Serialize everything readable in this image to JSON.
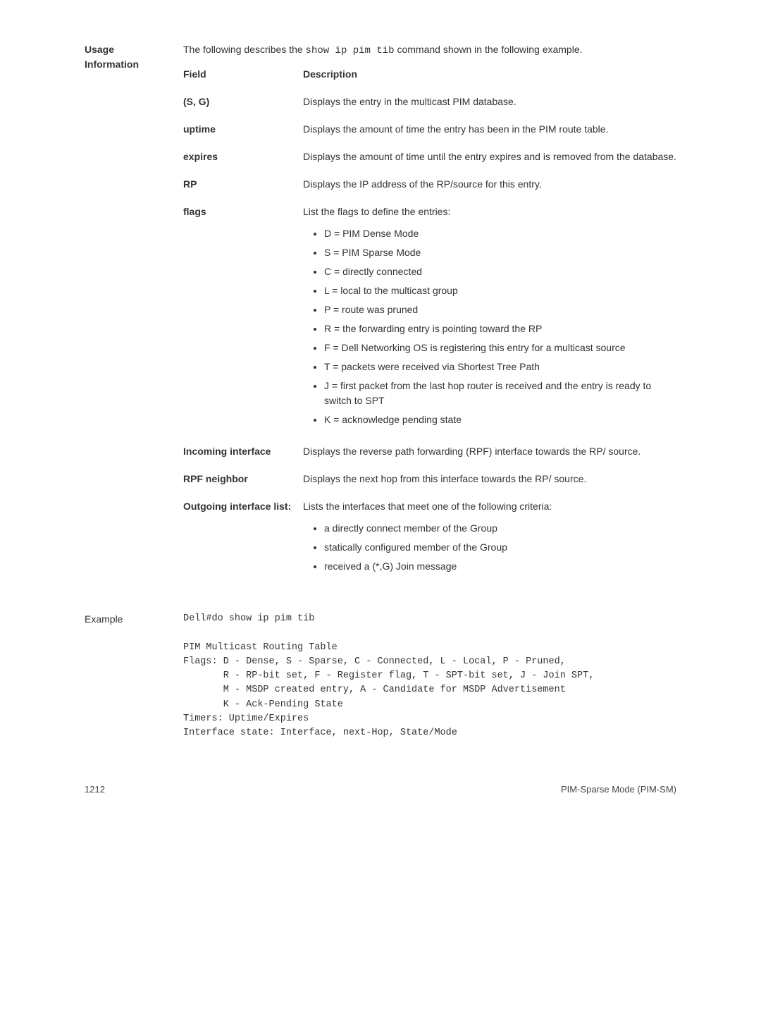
{
  "usage_info": {
    "side_label_line1": "Usage",
    "side_label_line2": "Information",
    "intro_prefix": "The following describes the ",
    "intro_code": "show ip pim tib",
    "intro_suffix": " command shown in the following example.",
    "header_field": "Field",
    "header_desc": "Description",
    "fields": [
      {
        "name": "(S, G)",
        "desc": "Displays the entry in the multicast PIM database."
      },
      {
        "name": "uptime",
        "desc": "Displays the amount of time the entry has been in the PIM route table."
      },
      {
        "name": "expires",
        "desc": "Displays the amount of time until the entry expires and is removed from the database."
      },
      {
        "name": "RP",
        "desc": "Displays the IP address of the RP/source for this entry."
      }
    ],
    "flags_label": "flags",
    "flags_intro": "List the flags to define the entries:",
    "flags_list": [
      "D = PIM Dense Mode",
      "S = PIM Sparse Mode",
      "C = directly connected",
      "L = local to the multicast group",
      "P = route was pruned",
      "R = the forwarding entry is pointing toward the RP",
      "F = Dell Networking OS is registering this entry for a multicast source",
      "T = packets were received via Shortest Tree Path",
      "J = first packet from the last hop router is received and the entry is ready to switch to SPT",
      "K = acknowledge pending state"
    ],
    "incoming_label": "Incoming interface",
    "incoming_desc": "Displays the reverse path forwarding (RPF) interface towards the RP/ source.",
    "rpf_label": "RPF neighbor",
    "rpf_desc": "Displays the next hop from this interface towards the RP/ source.",
    "outgoing_label": "Outgoing interface list:",
    "outgoing_intro": "Lists the interfaces that meet one of the following criteria:",
    "outgoing_list": [
      "a directly connect member of the Group",
      "statically configured member of the Group",
      "received a (*,G) Join message"
    ]
  },
  "example": {
    "side_label": "Example",
    "code": "Dell#do show ip pim tib\n\nPIM Multicast Routing Table\nFlags: D - Dense, S - Sparse, C - Connected, L - Local, P - Pruned,\n       R - RP-bit set, F - Register flag, T - SPT-bit set, J - Join SPT,\n       M - MSDP created entry, A - Candidate for MSDP Advertisement\n       K - Ack-Pending State\nTimers: Uptime/Expires\nInterface state: Interface, next-Hop, State/Mode"
  },
  "footer": {
    "page": "1212",
    "title": "PIM-Sparse Mode (PIM-SM)"
  }
}
